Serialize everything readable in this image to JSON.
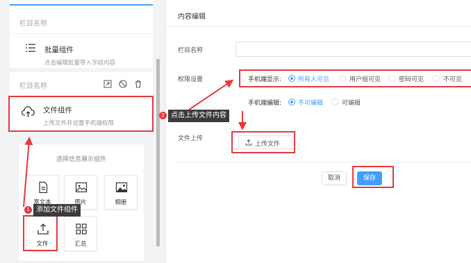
{
  "left": {
    "card1": {
      "title": "栏目名称",
      "component_name": "批量组件",
      "component_desc": "点击编辑批量导入字段内容",
      "icon": "list-icon"
    },
    "card2": {
      "title": "栏目名称",
      "component_name": "文件组件",
      "component_desc": "上传文件并设置手机端权限",
      "icon": "cloud-upload-icon",
      "tools": [
        "expand-icon",
        "ban-icon",
        "trash-icon"
      ]
    },
    "picker": {
      "heading": "选择信息展示组件",
      "tiles": [
        {
          "label": "富文本",
          "icon": "document-icon"
        },
        {
          "label": "图片",
          "icon": "image-icon"
        },
        {
          "label": "相册",
          "icon": "album-icon"
        },
        {
          "label": "文件",
          "icon": "upload-icon"
        },
        {
          "label": "汇总",
          "icon": "grid-icon"
        }
      ]
    }
  },
  "editor": {
    "title": "内容编辑",
    "column_name_label": "栏目名称",
    "column_name_value": "",
    "permission_label": "权限设置",
    "mobile_display_label": "手机端显示:",
    "mobile_display_options": [
      "所有人可见",
      "用户组可见",
      "密码可见",
      "不可见"
    ],
    "mobile_display_selected": "所有人可见",
    "mobile_edit_label": "手机端编辑:",
    "mobile_edit_options": [
      "不可编辑",
      "可编辑"
    ],
    "mobile_edit_selected": "不可编辑",
    "file_upload_label": "文件上传",
    "upload_button": "上传文件",
    "cancel_button": "取消",
    "save_button": "保存"
  },
  "annotations": {
    "step1_badge": "1",
    "step1_text": "添加文件组件",
    "step2_badge": "2",
    "step2_text": "点击上传文件内容"
  },
  "colors": {
    "accent": "#409eff",
    "highlight": "#e5393d",
    "tooltip_bg": "#3b3b3b"
  }
}
